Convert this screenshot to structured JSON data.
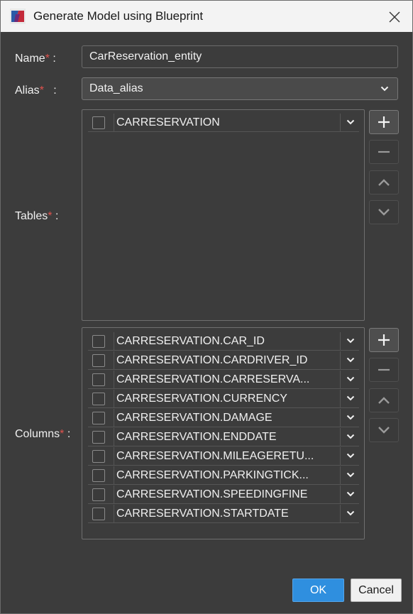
{
  "window": {
    "title": "Generate Model using Blueprint",
    "close_icon": "close-icon",
    "app_icon": "app-logo-icon"
  },
  "form": {
    "name": {
      "label": "Name",
      "required_mark": "*",
      "colon": ":",
      "value": "CarReservation_entity"
    },
    "alias": {
      "label": "Alias",
      "required_mark": "*",
      "colon": ":",
      "value": "Data_alias"
    },
    "tables": {
      "label": "Tables",
      "required_mark": "*",
      "colon": ":",
      "rows": [
        {
          "text": "CARRESERVATION",
          "checked": false
        }
      ],
      "buttons": [
        "add-icon",
        "remove-icon",
        "move-up-icon",
        "move-down-icon"
      ]
    },
    "columns": {
      "label": "Columns",
      "required_mark": "*",
      "colon": ":",
      "rows": [
        {
          "text": "CARRESERVATION.CAR_ID",
          "checked": false
        },
        {
          "text": "CARRESERVATION.CARDRIVER_ID",
          "checked": false
        },
        {
          "text": "CARRESERVATION.CARRESERVA...",
          "checked": false
        },
        {
          "text": "CARRESERVATION.CURRENCY",
          "checked": false
        },
        {
          "text": "CARRESERVATION.DAMAGE",
          "checked": false
        },
        {
          "text": "CARRESERVATION.ENDDATE",
          "checked": false
        },
        {
          "text": "CARRESERVATION.MILEAGERETU...",
          "checked": false
        },
        {
          "text": "CARRESERVATION.PARKINGTICK...",
          "checked": false
        },
        {
          "text": "CARRESERVATION.SPEEDINGFINE",
          "checked": false
        },
        {
          "text": "CARRESERVATION.STARTDATE",
          "checked": false
        }
      ],
      "buttons": [
        "add-icon",
        "remove-icon",
        "move-up-icon",
        "move-down-icon"
      ]
    }
  },
  "footer": {
    "ok_label": "OK",
    "cancel_label": "Cancel"
  },
  "colors": {
    "background": "#3c3c3c",
    "titlebar": "#f3f3f3",
    "required": "#e0524d",
    "ok_button": "#2f8fdf"
  }
}
